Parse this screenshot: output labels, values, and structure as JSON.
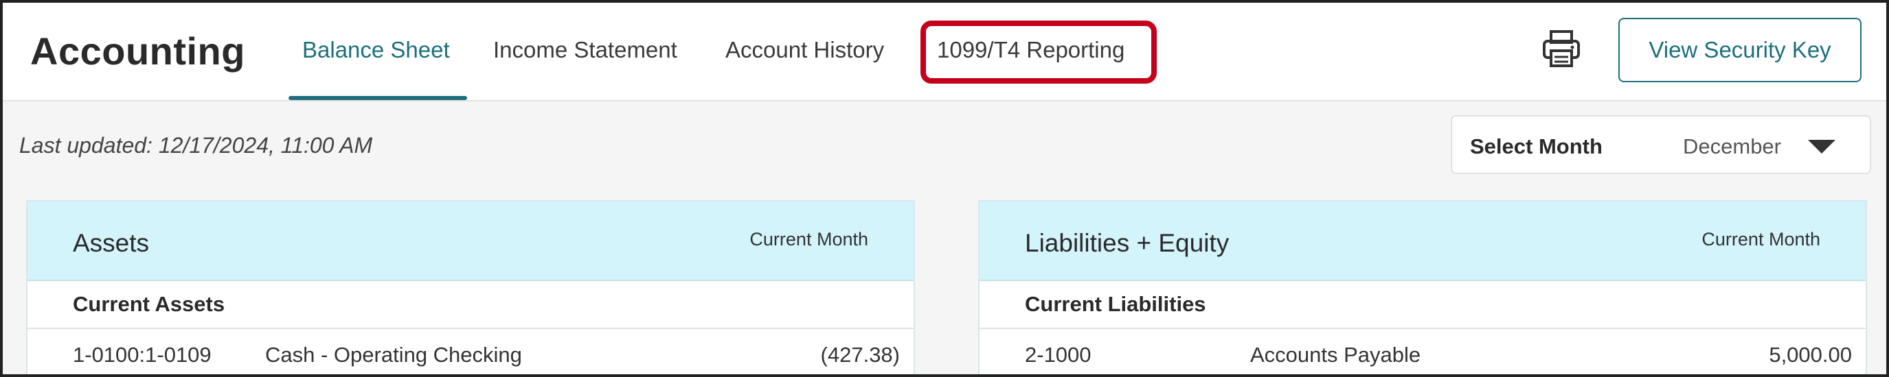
{
  "header": {
    "app_title": "Accounting",
    "tabs": [
      {
        "label": "Balance Sheet",
        "active": true
      },
      {
        "label": "Income Statement",
        "active": false
      },
      {
        "label": "Account History",
        "active": false
      },
      {
        "label": "1099/T4 Reporting",
        "active": false,
        "highlighted": true
      }
    ],
    "print_icon": "printer-icon",
    "security_key_label": "View Security Key"
  },
  "toolbar": {
    "last_updated": "Last updated: 12/17/2024, 11:00 AM",
    "month_select": {
      "label": "Select Month",
      "value": "December",
      "icon": "caret-down-icon"
    }
  },
  "assets": {
    "title": "Assets",
    "column_header": "Current Month",
    "section": "Current Assets",
    "rows": [
      {
        "account": "1-0100:1-0109",
        "name": "Cash - Operating Checking",
        "amount": "(427.38)"
      }
    ]
  },
  "liabilities": {
    "title": "Liabilities + Equity",
    "column_header": "Current Month",
    "section": "Current Liabilities",
    "rows": [
      {
        "account": "2-1000",
        "name": "Accounts Payable",
        "amount": "5,000.00"
      }
    ]
  },
  "colors": {
    "accent": "#1d6f7d",
    "highlight": "#c4001a",
    "panel_header_bg": "#d3f4fb"
  }
}
